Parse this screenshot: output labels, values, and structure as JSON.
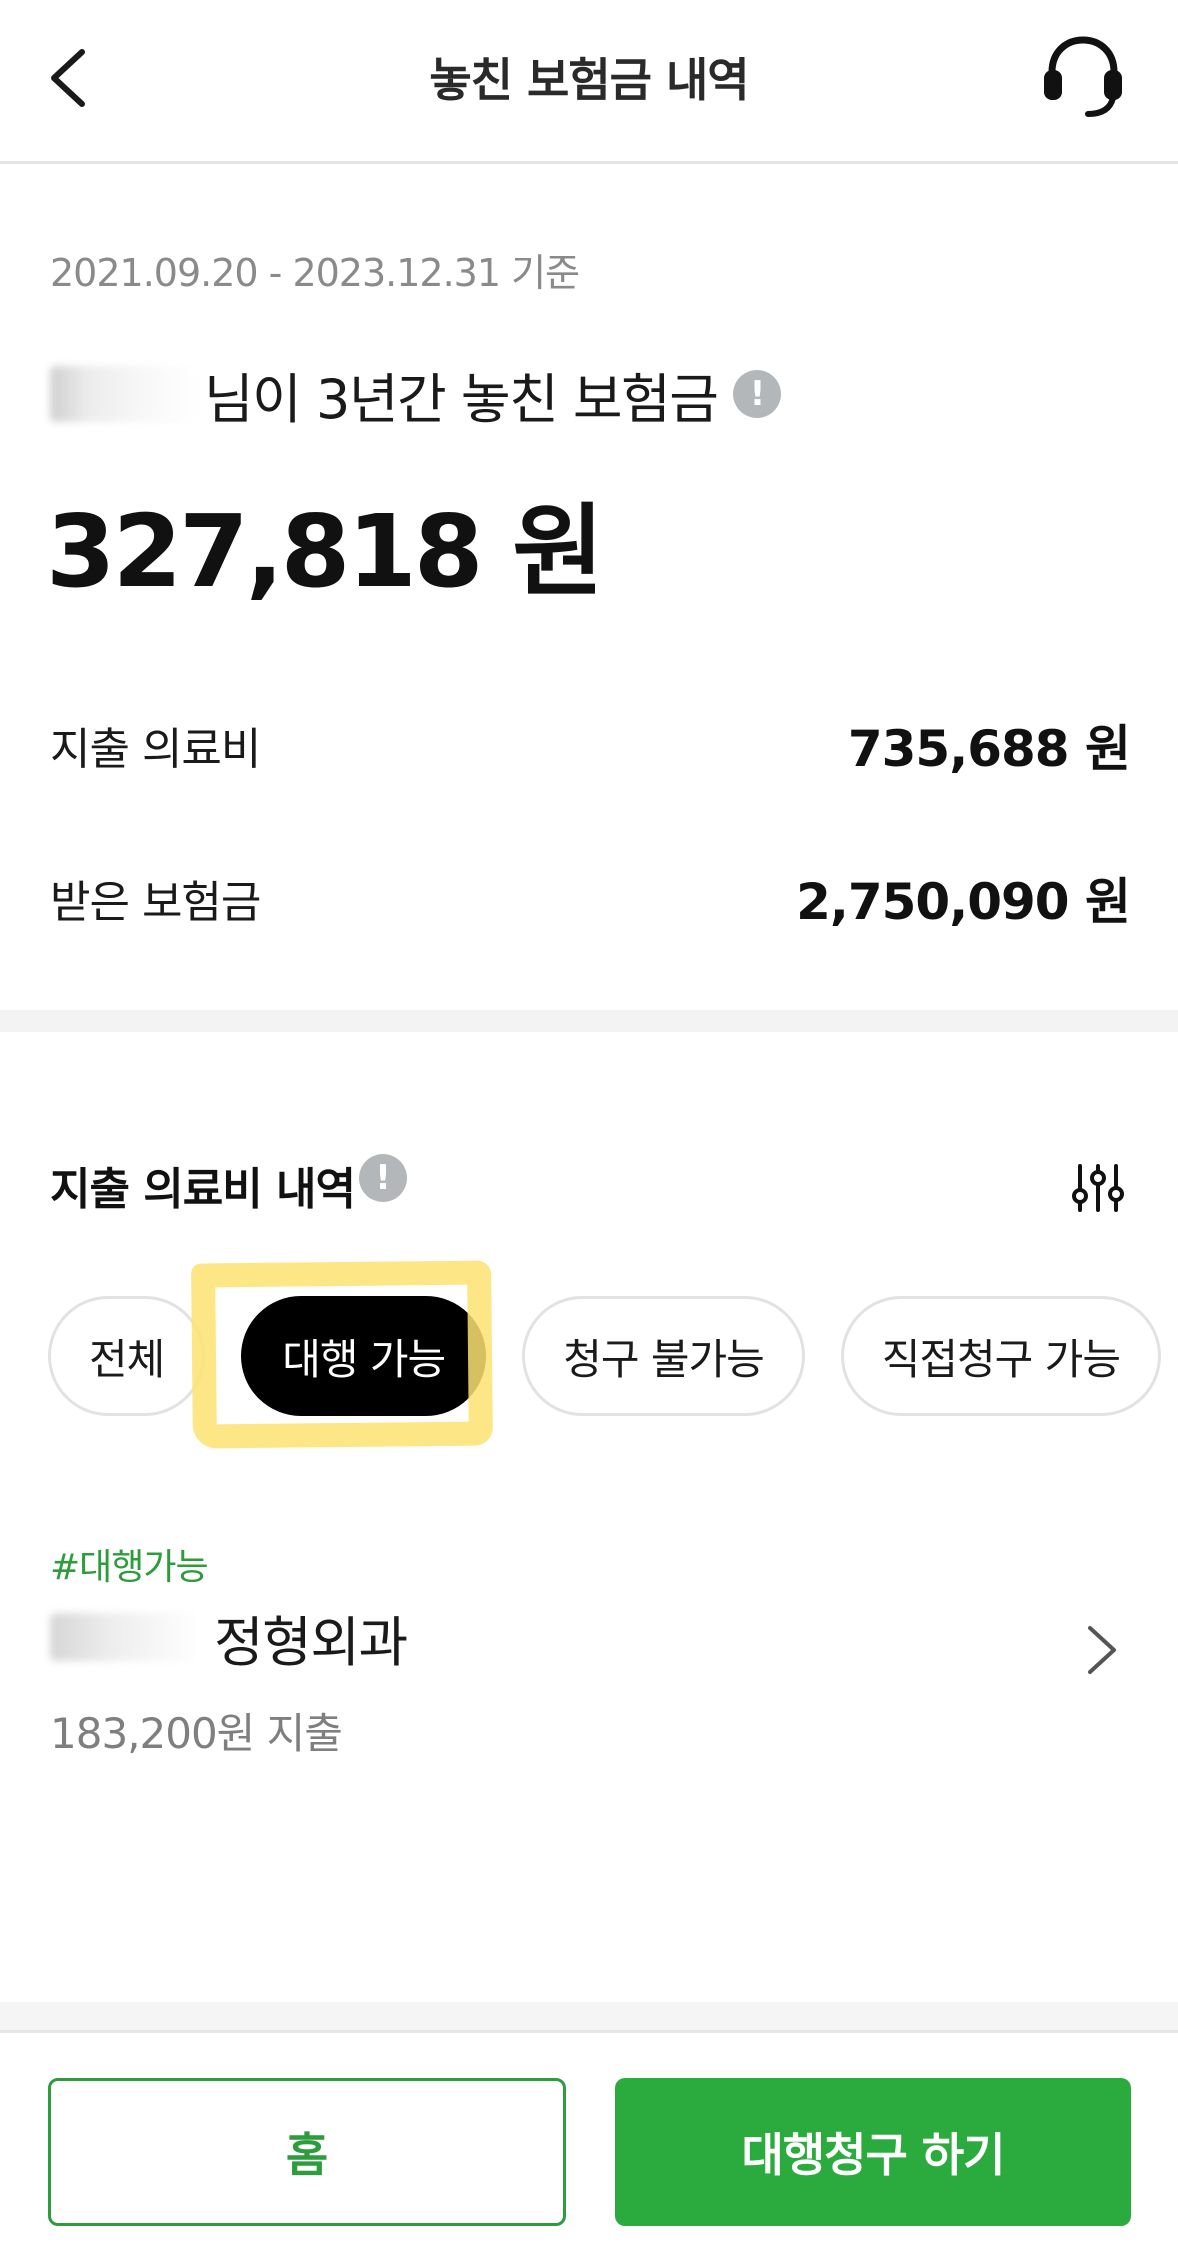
{
  "header": {
    "title": "놓친 보험금 내역",
    "back_icon": "chevron-left-icon",
    "support_icon": "headset-icon"
  },
  "summary": {
    "period": "2021.09.20 - 2023.12.31 기준",
    "missed_label_suffix": "님이 3년간 놓친 보험금",
    "info_icon": "!",
    "missed_total": "327,818 원",
    "spent_label": "지출 의료비",
    "spent_value": "735,688 원",
    "received_label": "받은 보험금",
    "received_value": "2,750,090 원"
  },
  "expenses": {
    "title": "지출 의료비 내역",
    "info_icon": "!",
    "filter_icon": "sliders-icon",
    "chips": [
      {
        "label": "전체",
        "active": false
      },
      {
        "label": "대행 가능",
        "active": true
      },
      {
        "label": "청구 불가능",
        "active": false
      },
      {
        "label": "직접청구 가능",
        "active": false
      }
    ],
    "items": [
      {
        "tag": "#대행가능",
        "name_suffix": "정형외과",
        "spent": "183,200원 지출"
      }
    ]
  },
  "footer": {
    "home_label": "홈",
    "claim_label": "대행청구 하기"
  },
  "colors": {
    "accent_green": "#2bab3e",
    "tag_green": "#2c9c3c",
    "highlight_yellow": "#fde270"
  }
}
